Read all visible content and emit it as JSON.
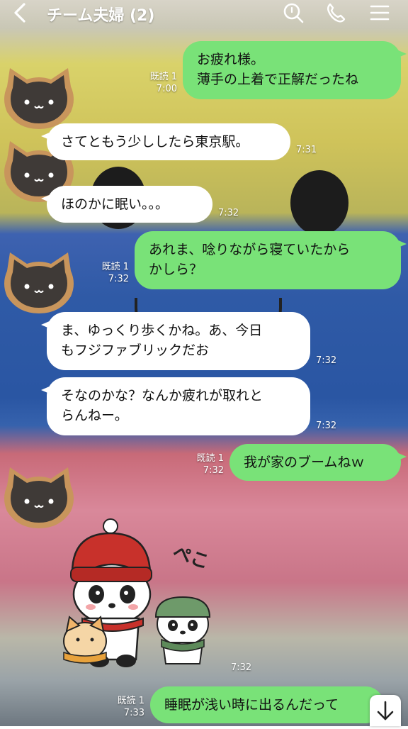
{
  "header": {
    "title": "チーム夫婦 (2)"
  },
  "messages": [
    {
      "side": "right",
      "lines": [
        "お疲れ様。",
        "薄手の上着で正解だったね"
      ],
      "read": "既読 1",
      "time": "7:00"
    },
    {
      "side": "left",
      "lines": [
        "さてともう少ししたら東京駅。"
      ],
      "time": "7:31"
    },
    {
      "side": "left",
      "lines": [
        "ほのかに眠い。。。"
      ],
      "time": "7:32"
    },
    {
      "side": "right",
      "lines": [
        "あれま、唸りながら寝ていたから",
        "かしら？"
      ],
      "read": "既読 1",
      "time": "7:32"
    },
    {
      "side": "left",
      "lines": [
        "ま、ゆっくり歩くかね。あ、今日",
        "もフジファブリックだお"
      ],
      "time": "7:32"
    },
    {
      "side": "left",
      "lines": [
        "そなのかな？なんか疲れが取れと",
        "らんねー。"
      ],
      "time": "7:32"
    },
    {
      "side": "right",
      "lines": [
        "我が家のブームねｗ"
      ],
      "read": "既読 1",
      "time": "7:32"
    },
    {
      "side": "left",
      "sticker": "panda-sticker",
      "sticker_text": "ぺこ",
      "time": "7:32"
    },
    {
      "side": "right",
      "lines": [
        "睡眠が浅い時に出るんだって"
      ],
      "read": "既読 1",
      "time": "7:33"
    }
  ],
  "icons": {
    "back": "chevron-left-icon",
    "search": "search-icon",
    "call": "phone-icon",
    "menu": "hamburger-menu-icon",
    "scroll": "arrow-down-icon"
  },
  "colors": {
    "my_bubble": "#79e278",
    "other_bubble": "#ffffff"
  }
}
